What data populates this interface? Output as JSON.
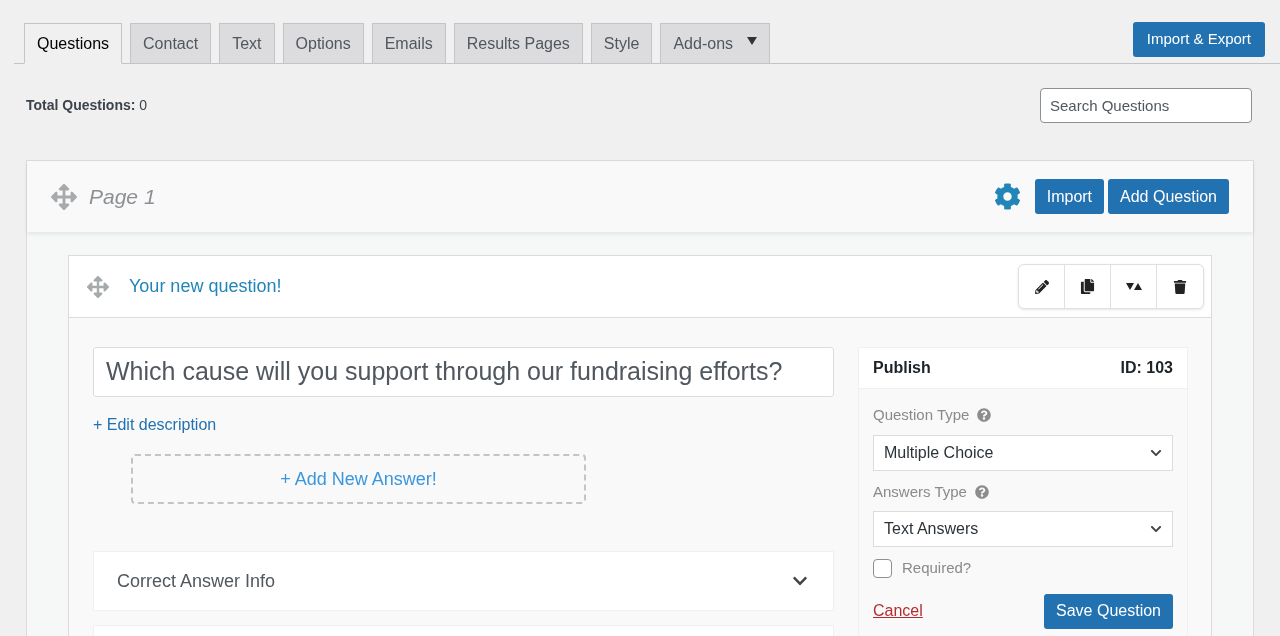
{
  "tabs": [
    {
      "label": "Questions",
      "selected": true,
      "dropdown": false
    },
    {
      "label": "Contact",
      "selected": false,
      "dropdown": false
    },
    {
      "label": "Text",
      "selected": false,
      "dropdown": false
    },
    {
      "label": "Options",
      "selected": false,
      "dropdown": false
    },
    {
      "label": "Emails",
      "selected": false,
      "dropdown": false
    },
    {
      "label": "Results Pages",
      "selected": false,
      "dropdown": false
    },
    {
      "label": "Style",
      "selected": false,
      "dropdown": false
    },
    {
      "label": "Add-ons",
      "selected": false,
      "dropdown": true
    }
  ],
  "import_export_button": "Import & Export",
  "total_questions": {
    "label": "Total Questions:",
    "value": "0"
  },
  "search": {
    "placeholder": "Search Questions"
  },
  "page": {
    "title": "Page 1",
    "buttons": [
      "Import",
      "Add Question"
    ]
  },
  "question": {
    "title": "Your new question!",
    "text": "Which cause will you support through our fundraising efforts?",
    "edit_description": "+ Edit description",
    "add_answer": "+ Add New Answer!",
    "sections": [
      {
        "label": "Correct Answer Info",
        "expanded": false
      }
    ]
  },
  "publish": {
    "title": "Publish",
    "id": "ID: 103",
    "question_type": {
      "label": "Question Type",
      "value": "Multiple Choice"
    },
    "answers_type": {
      "label": "Answers Type",
      "value": "Text Answers"
    },
    "required": {
      "label": "Required?",
      "checked": false
    },
    "cancel": "Cancel",
    "save": "Save Question"
  }
}
